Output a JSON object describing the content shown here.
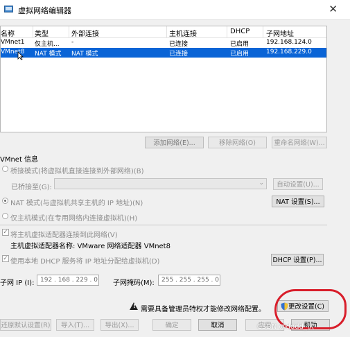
{
  "window": {
    "title": "虚拟网络编辑器",
    "close_icon": "close-icon"
  },
  "grid": {
    "headers": [
      "名称",
      "类型",
      "外部连接",
      "主机连接",
      "DHCP",
      "子网地址"
    ],
    "rows": [
      [
        "VMnet1",
        "仅主机...",
        "-",
        "已连接",
        "已启用",
        "192.168.124.0"
      ],
      [
        "VMnet8",
        "NAT 模式",
        "NAT 模式",
        "已连接",
        "已启用",
        "192.168.229.0"
      ]
    ]
  },
  "network_buttons": {
    "add": "添加网络(E)...",
    "remove": "移除网络(O)",
    "rename": "重命名网络(W)..."
  },
  "vmnet_info": {
    "section_label": "VMnet 信息",
    "bridged_label": "桥接模式(将虚拟机直接连接到外部网络)(B)",
    "bridged_to_label": "已桥接至(G):",
    "auto_settings": "自动设置(U)...",
    "nat_label": "NAT 模式(与虚拟机共享主机的 IP 地址)(N)",
    "nat_settings": "NAT 设置(S)...",
    "host_only_label": "仅主机模式(在专用网络内连接虚拟机)(H)",
    "connect_adapter_label": "将主机虚拟适配器连接到此网络(V)",
    "adapter_name_label": "主机虚拟适配器名称: VMware 网络适配器 VMnet8",
    "dhcp_label": "使用本地 DHCP 服务将 IP 地址分配给虚拟机(D)",
    "dhcp_settings": "DHCP 设置(P)...",
    "subnet_ip_label": "子网 IP (I):",
    "subnet_ip_value": "192 . 168 . 229 . 0",
    "subnet_mask_label": "子网掩码(M):",
    "subnet_mask_value": "255 . 255 . 255 . 0"
  },
  "warning": {
    "text": "需要具备管理员特权才能修改网络配置。",
    "change_settings": "更改设置(C)"
  },
  "footer": {
    "restore": "还原默认设置(R)",
    "import": "导入(T)...",
    "export": "导出(X)...",
    "ok": "确定",
    "cancel": "取消",
    "apply": "应用",
    "help": "帮助"
  },
  "watermark": "CSDN @dddd_伏",
  "colors": {
    "selection": "#0a64d6",
    "annotation": "#d81d2a"
  }
}
